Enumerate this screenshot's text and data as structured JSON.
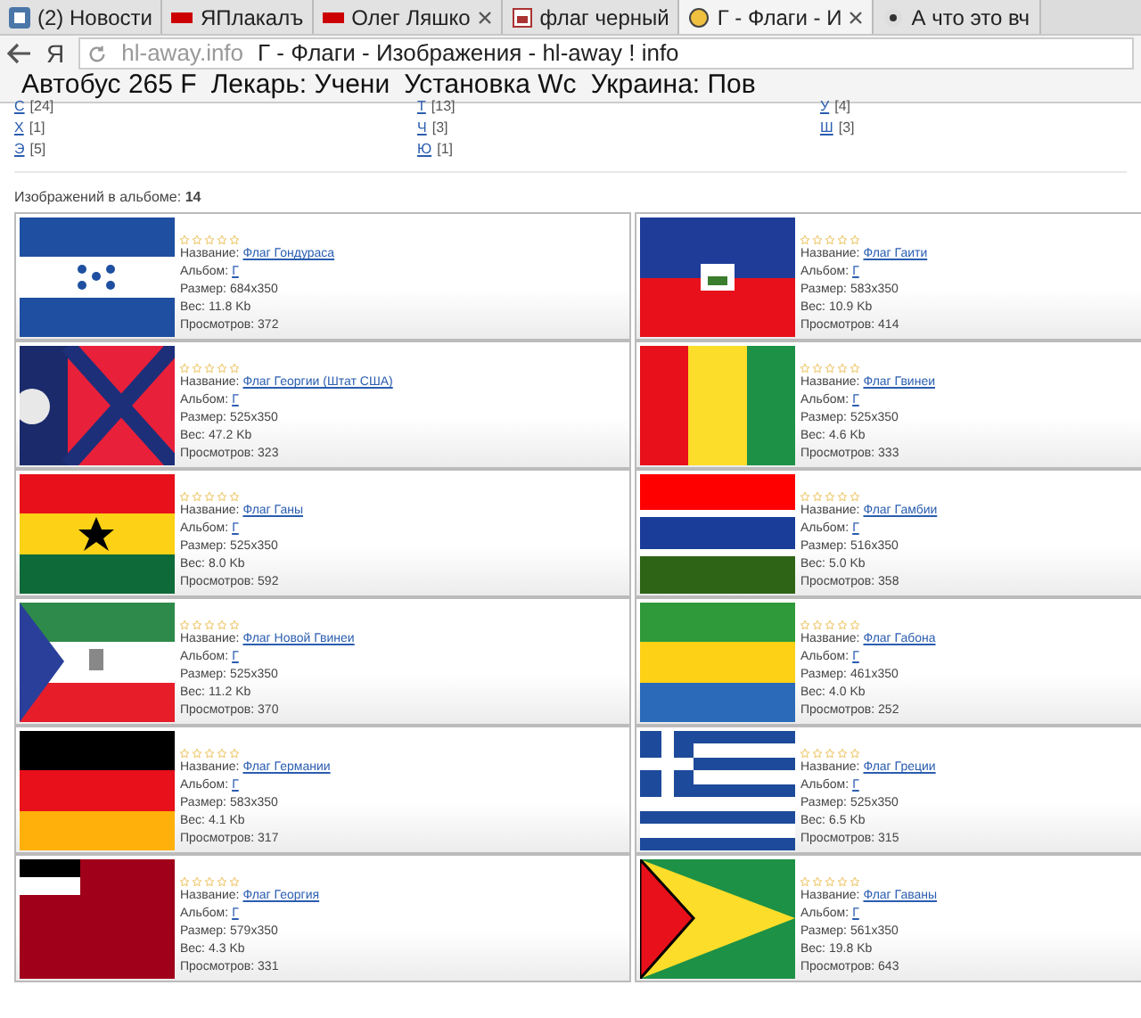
{
  "tabs": [
    {
      "label": "(2) Новости",
      "closable": false,
      "selected": false
    },
    {
      "label": "ЯПлакалъ",
      "closable": false,
      "selected": false
    },
    {
      "label": "Олег Ляшко",
      "closable": true,
      "selected": false
    },
    {
      "label": "флаг черный",
      "closable": false,
      "selected": false
    },
    {
      "label": "Г - Флаги - И",
      "closable": true,
      "selected": true
    },
    {
      "label": "А что это вч",
      "closable": false,
      "selected": false
    }
  ],
  "toolbar": {
    "browser_mark": "Я",
    "domain": "hl-away.info",
    "page_title": "Г - Флаги - Изображения - hl-away ! info"
  },
  "bookmarks": [
    "Автобус 265 F",
    "Лекарь: Учени",
    "Установка Wc",
    "Украина: Пов"
  ],
  "letter_index": [
    [
      {
        "letter": "С",
        "count": "[24]"
      },
      {
        "letter": "Т",
        "count": "[13]"
      },
      {
        "letter": "У",
        "count": "[4]"
      }
    ],
    [
      {
        "letter": "Х",
        "count": "[1]"
      },
      {
        "letter": "Ч",
        "count": "[3]"
      },
      {
        "letter": "Ш",
        "count": "[3]"
      }
    ],
    [
      {
        "letter": "Э",
        "count": "[5]"
      },
      {
        "letter": "Ю",
        "count": "[1]"
      }
    ]
  ],
  "album_count": {
    "label": "Изображений в альбоме:",
    "value": "14"
  },
  "images": [
    {
      "stars": 0,
      "fields": [
        {
          "kind": "link",
          "label": "Название:",
          "value": "Флаг Гондураса"
        },
        {
          "kind": "link",
          "label": "Альбом:",
          "value": "Г"
        },
        {
          "kind": "text",
          "label": "Размер:",
          "value": "684x350"
        },
        {
          "kind": "text",
          "label": "Вес:",
          "value": "11.8 Kb"
        },
        {
          "kind": "text",
          "label": "Просмотров:",
          "value": "372"
        }
      ]
    },
    {
      "stars": 0,
      "fields": [
        {
          "kind": "link",
          "label": "Название:",
          "value": "Флаг Гаити"
        },
        {
          "kind": "link",
          "label": "Альбом:",
          "value": "Г"
        },
        {
          "kind": "text",
          "label": "Размер:",
          "value": "583x350"
        },
        {
          "kind": "text",
          "label": "Вес:",
          "value": "10.9 Kb"
        },
        {
          "kind": "text",
          "label": "Просмотров:",
          "value": "414"
        }
      ]
    },
    {
      "stars": 0,
      "fields": [
        {
          "kind": "link",
          "label": "Название:",
          "value": "Флаг Георгии (Штат США)"
        },
        {
          "kind": "link",
          "label": "Альбом:",
          "value": "Г"
        },
        {
          "kind": "text",
          "label": "Размер:",
          "value": "525x350"
        },
        {
          "kind": "text",
          "label": "Вес:",
          "value": "47.2 Kb"
        },
        {
          "kind": "text",
          "label": "Просмотров:",
          "value": "323"
        }
      ]
    },
    {
      "stars": 0,
      "fields": [
        {
          "kind": "link",
          "label": "Название:",
          "value": "Флаг Гвинеи"
        },
        {
          "kind": "link",
          "label": "Альбом:",
          "value": "Г"
        },
        {
          "kind": "text",
          "label": "Размер:",
          "value": "525x350"
        },
        {
          "kind": "text",
          "label": "Вес:",
          "value": "4.6 Kb"
        },
        {
          "kind": "text",
          "label": "Просмотров:",
          "value": "333"
        }
      ]
    },
    {
      "stars": 0,
      "fields": [
        {
          "kind": "link",
          "label": "Название:",
          "value": "Флаг Ганы"
        },
        {
          "kind": "link",
          "label": "Альбом:",
          "value": "Г"
        },
        {
          "kind": "text",
          "label": "Размер:",
          "value": "525x350"
        },
        {
          "kind": "text",
          "label": "Вес:",
          "value": "8.0 Kb"
        },
        {
          "kind": "text",
          "label": "Просмотров:",
          "value": "592"
        }
      ]
    },
    {
      "stars": 0,
      "fields": [
        {
          "kind": "link",
          "label": "Название:",
          "value": "Флаг Гамбии"
        },
        {
          "kind": "link",
          "label": "Альбом:",
          "value": "Г"
        },
        {
          "kind": "text",
          "label": "Размер:",
          "value": "516x350"
        },
        {
          "kind": "text",
          "label": "Вес:",
          "value": "5.0 Kb"
        },
        {
          "kind": "text",
          "label": "Просмотров:",
          "value": "358"
        }
      ]
    },
    {
      "stars": 0,
      "fields": [
        {
          "kind": "link",
          "label": "Название:",
          "value": "Флаг Новой Гвинеи"
        },
        {
          "kind": "link",
          "label": "Альбом:",
          "value": "Г"
        },
        {
          "kind": "text",
          "label": "Размер:",
          "value": "525x350"
        },
        {
          "kind": "text",
          "label": "Вес:",
          "value": "11.2 Kb"
        },
        {
          "kind": "text",
          "label": "Просмотров:",
          "value": "370"
        }
      ]
    },
    {
      "stars": 0,
      "fields": [
        {
          "kind": "link",
          "label": "Название:",
          "value": "Флаг Габона"
        },
        {
          "kind": "link",
          "label": "Альбом:",
          "value": "Г"
        },
        {
          "kind": "text",
          "label": "Размер:",
          "value": "461x350"
        },
        {
          "kind": "text",
          "label": "Вес:",
          "value": "4.0 Kb"
        },
        {
          "kind": "text",
          "label": "Просмотров:",
          "value": "252"
        }
      ]
    },
    {
      "stars": 0,
      "fields": [
        {
          "kind": "link",
          "label": "Название:",
          "value": "Флаг Германии"
        },
        {
          "kind": "link",
          "label": "Альбом:",
          "value": "Г"
        },
        {
          "kind": "text",
          "label": "Размер:",
          "value": "583x350"
        },
        {
          "kind": "text",
          "label": "Вес:",
          "value": "4.1 Kb"
        },
        {
          "kind": "text",
          "label": "Просмотров:",
          "value": "317"
        }
      ]
    },
    {
      "stars": 0,
      "fields": [
        {
          "kind": "link",
          "label": "Название:",
          "value": "Флаг Греции"
        },
        {
          "kind": "link",
          "label": "Альбом:",
          "value": "Г"
        },
        {
          "kind": "text",
          "label": "Размер:",
          "value": "525x350"
        },
        {
          "kind": "text",
          "label": "Вес:",
          "value": "6.5 Kb"
        },
        {
          "kind": "text",
          "label": "Просмотров:",
          "value": "315"
        }
      ]
    },
    {
      "stars": 0,
      "fields": [
        {
          "kind": "link",
          "label": "Название:",
          "value": "Флаг Георгия"
        },
        {
          "kind": "link",
          "label": "Альбом:",
          "value": "Г"
        },
        {
          "kind": "text",
          "label": "Размер:",
          "value": "579x350"
        },
        {
          "kind": "text",
          "label": "Вес:",
          "value": "4.3 Kb"
        },
        {
          "kind": "text",
          "label": "Просмотров:",
          "value": "331"
        }
      ]
    },
    {
      "stars": 0,
      "fields": [
        {
          "kind": "link",
          "label": "Название:",
          "value": "Флаг Гаваны"
        },
        {
          "kind": "link",
          "label": "Альбом:",
          "value": "Г"
        },
        {
          "kind": "text",
          "label": "Размер:",
          "value": "561x350"
        },
        {
          "kind": "text",
          "label": "Вес:",
          "value": "19.8 Kb"
        },
        {
          "kind": "text",
          "label": "Просмотров:",
          "value": "643"
        }
      ]
    }
  ]
}
